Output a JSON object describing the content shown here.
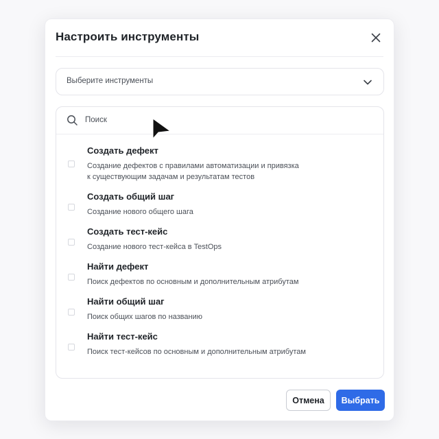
{
  "dialog": {
    "title": "Настроить инструменты",
    "close_icon": "close-icon"
  },
  "selector": {
    "placeholder": "Выберите инструменты",
    "chevron_icon": "chevron-down-icon"
  },
  "search": {
    "placeholder": "Поиск",
    "value": "",
    "icon": "search-icon"
  },
  "tools": [
    {
      "title": "Создать дефект",
      "description_lines": [
        "Создание дефектов с правилами автоматизации и привязка",
        "к существующим задачам и результатам тестов"
      ],
      "checked": false
    },
    {
      "title": "Создать общий шаг",
      "description_lines": [
        "Создание нового общего шага"
      ],
      "checked": false
    },
    {
      "title": "Создать тест-кейс",
      "description_lines": [
        "Создание нового тест-кейса в TestOps"
      ],
      "checked": false
    },
    {
      "title": "Найти дефект",
      "description_lines": [
        "Поиск дефектов по основным и дополнительным атрибутам"
      ],
      "checked": false
    },
    {
      "title": "Найти общий шаг",
      "description_lines": [
        "Поиск общих шагов по названию"
      ],
      "checked": false
    },
    {
      "title": "Найти тест-кейс",
      "description_lines": [
        "Поиск тест-кейсов по основным и дополнительным атрибутам"
      ],
      "checked": false
    }
  ],
  "footer": {
    "cancel_label": "Отмена",
    "confirm_label": "Выбрать"
  },
  "colors": {
    "primary": "#2f6be7",
    "text": "#1f2328",
    "muted_text": "#4a4f57",
    "border": "#e4e4ea",
    "background": "#f8f8fa"
  },
  "pointer_icon": "mouse-pointer-icon"
}
